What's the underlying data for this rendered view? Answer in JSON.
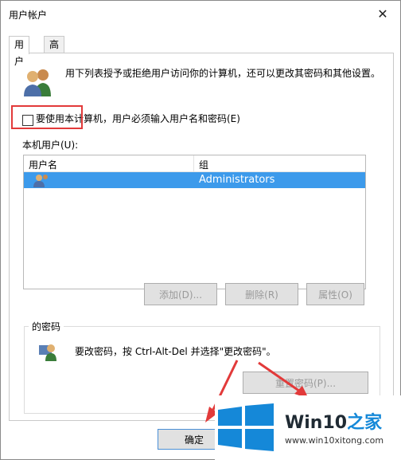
{
  "window": {
    "title": "用户帐户",
    "close_glyph": "✕"
  },
  "tabs": [
    {
      "label": "用户"
    },
    {
      "label": "高级"
    }
  ],
  "description": "用下列表授予或拒绝用户访问你的计算机，还可以更改其密码和其他设置。",
  "require_login": {
    "label": "要使用本计算机，用户必须输入用户名和密码(E)",
    "checked": false
  },
  "local_users": {
    "label": "本机用户(U):",
    "columns": [
      "用户名",
      "组"
    ],
    "rows": [
      {
        "name": "",
        "group": "Administrators",
        "selected": true
      }
    ]
  },
  "buttons": {
    "add": "添加(D)...",
    "remove": "删除(R)",
    "properties": "属性(O)"
  },
  "password_group": {
    "title": "的密码",
    "text": "要改密码，按 Ctrl-Alt-Del 并选择\"更改密码\"。",
    "reset_button": "重置密码(P)..."
  },
  "footer": {
    "ok": "确定"
  },
  "watermark": {
    "brand_prefix": "Win10",
    "brand_suffix": "之家",
    "url": "www.win10xitong.com"
  },
  "colors": {
    "selection": "#3c9aeb",
    "highlight_box": "#e23a3a",
    "logo_blue": "#1588d8"
  }
}
